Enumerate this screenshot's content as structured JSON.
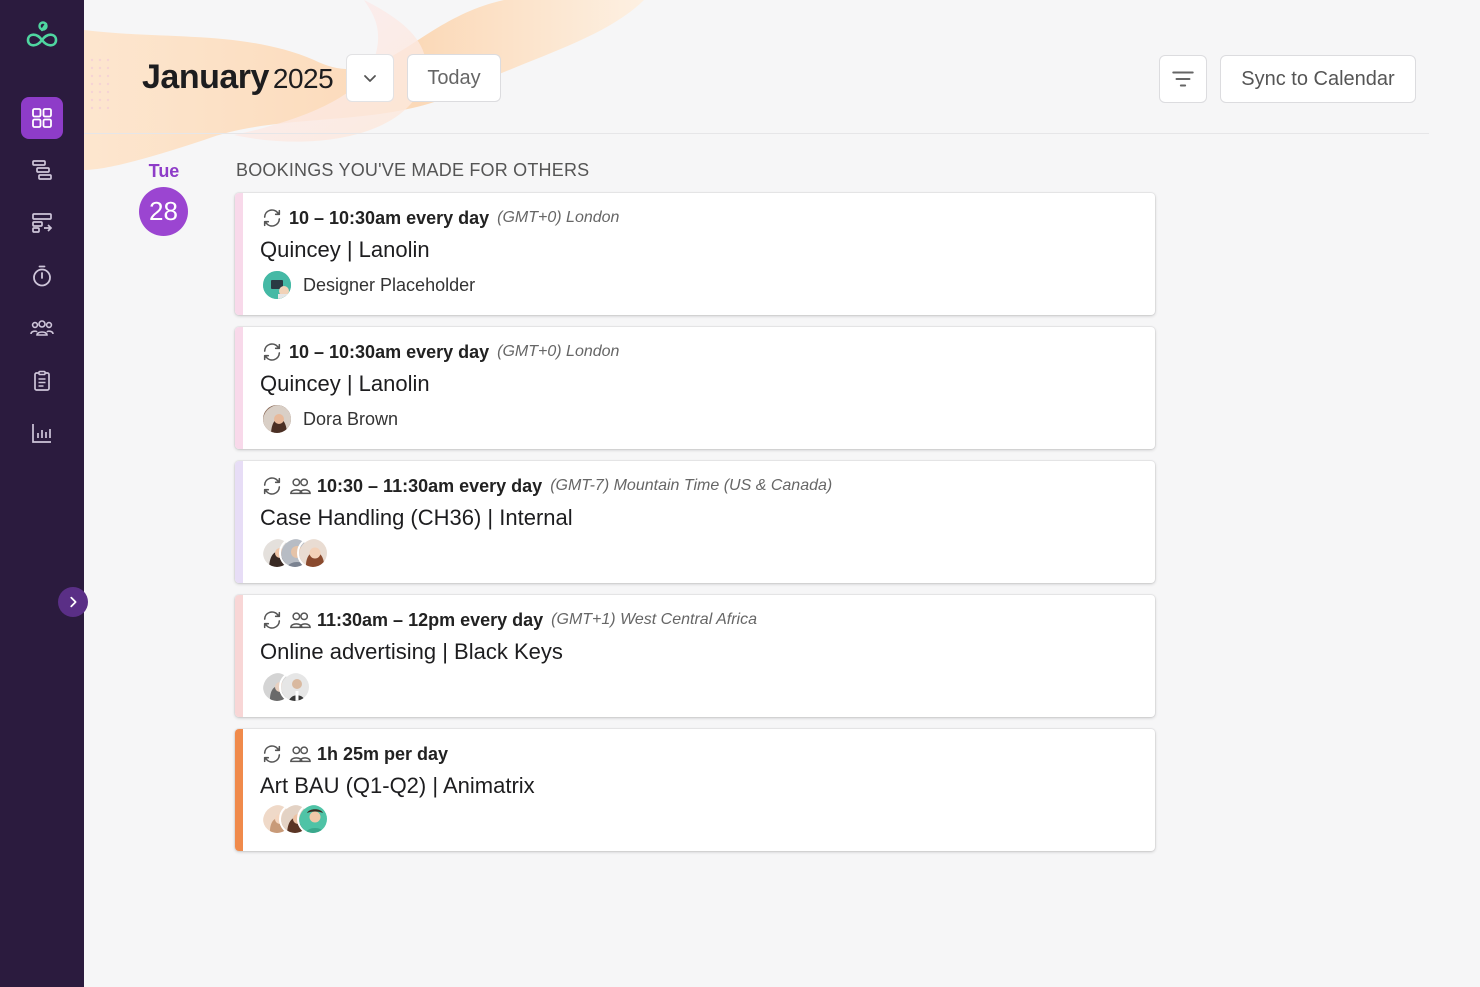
{
  "header": {
    "month": "January",
    "year": "2025",
    "today_label": "Today",
    "sync_label": "Sync to Calendar"
  },
  "date": {
    "day_name": "Tue",
    "day_number": "28"
  },
  "section_title": "BOOKINGS YOU'VE MADE FOR OTHERS",
  "sidebar": {
    "items": [
      {
        "name": "dashboard-icon",
        "active": true
      },
      {
        "name": "projects-icon",
        "active": false
      },
      {
        "name": "schedule-icon",
        "active": false
      },
      {
        "name": "timer-icon",
        "active": false
      },
      {
        "name": "people-icon",
        "active": false
      },
      {
        "name": "clipboard-icon",
        "active": false
      },
      {
        "name": "reports-icon",
        "active": false
      }
    ]
  },
  "colors": {
    "sidebar_bg": "#2b1b3e",
    "accent_purple": "#8e3cc8",
    "logo_green": "#4fd6a0",
    "card_accent_pink": "#f8d9ea",
    "card_accent_lavender": "#e7ddf6",
    "card_accent_rose": "#f8d6d6",
    "card_accent_orange": "#f08a4b"
  },
  "bookings": [
    {
      "time": "10 – 10:30am every day",
      "timezone": "(GMT+0) London",
      "title": "Quincey | Lanolin",
      "person": "Designer Placeholder",
      "group": false
    },
    {
      "time": "10 – 10:30am every day",
      "timezone": "(GMT+0) London",
      "title": "Quincey | Lanolin",
      "person": "Dora Brown",
      "group": false
    },
    {
      "time": "10:30 – 11:30am every day",
      "timezone": "(GMT-7) Mountain Time (US & Canada)",
      "title": "Case Handling (CH36) | Internal",
      "group": true
    },
    {
      "time": "11:30am – 12pm every day",
      "timezone": "(GMT+1) West Central Africa",
      "title": "Online advertising | Black Keys",
      "group": true
    },
    {
      "time": "1h 25m per day",
      "timezone": "",
      "title": "Art BAU (Q1-Q2) | Animatrix",
      "group": true
    }
  ]
}
